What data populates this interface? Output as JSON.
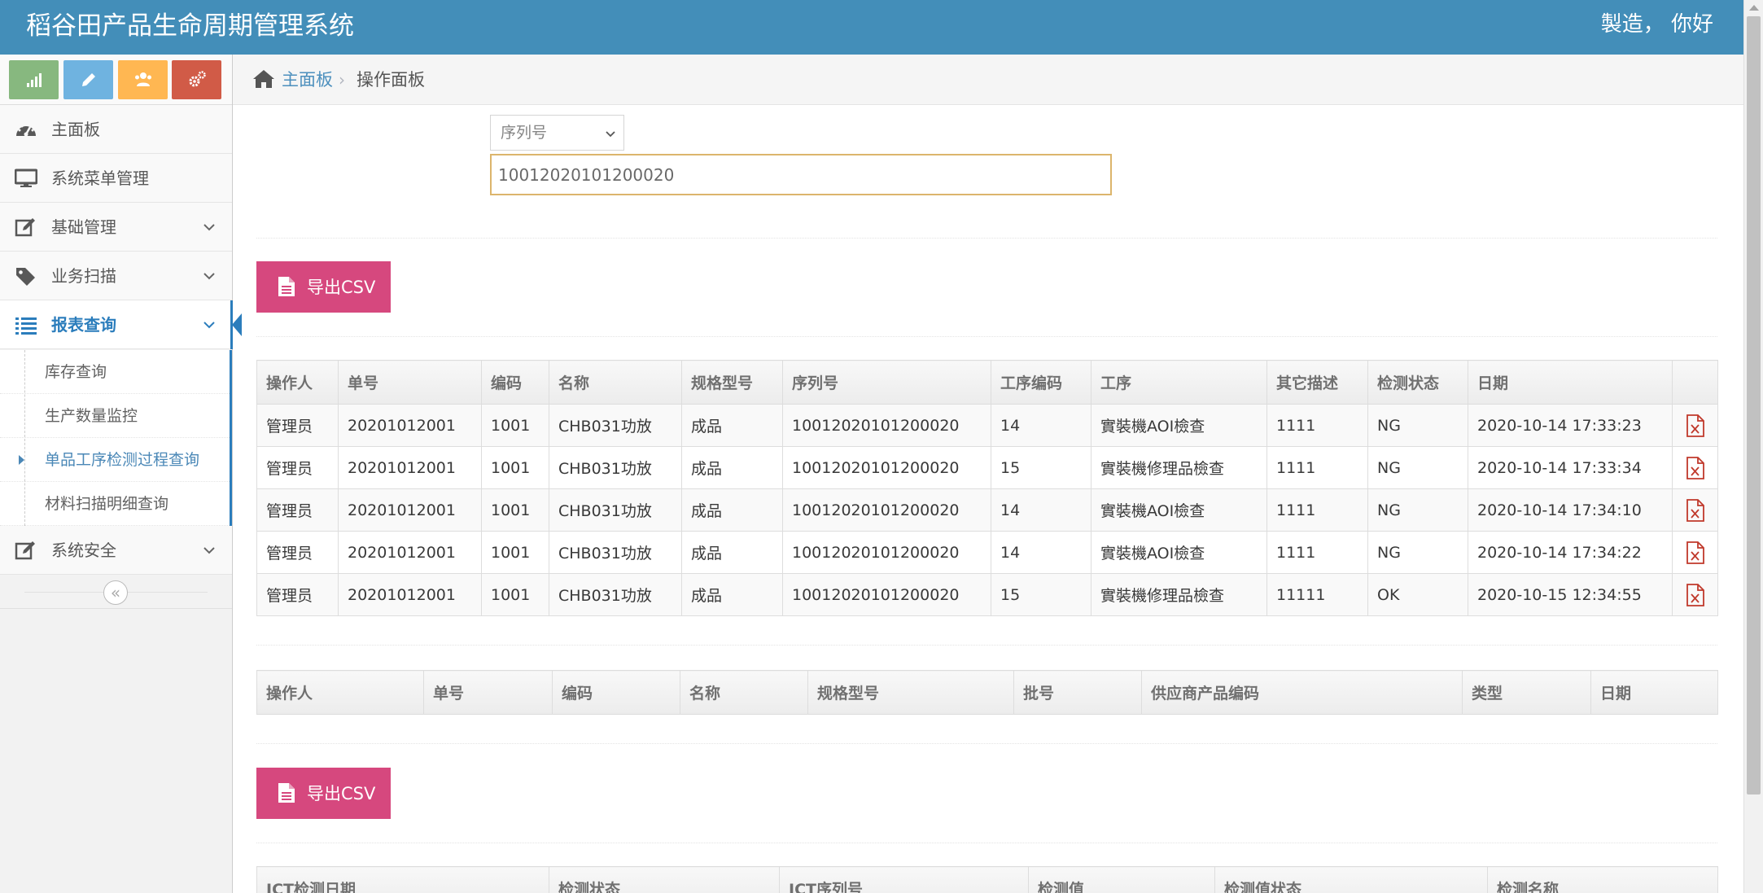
{
  "header": {
    "title": "稻谷田产品生命周期管理系统",
    "greeting": "製造， 你好"
  },
  "sidebar": {
    "shortcuts": [
      {
        "icon": "signal-icon",
        "color": "#87b87f"
      },
      {
        "icon": "pencil-icon",
        "color": "#6fb3e0"
      },
      {
        "icon": "users-icon",
        "color": "#ffb752"
      },
      {
        "icon": "cogs-icon",
        "color": "#d15b47"
      }
    ],
    "items": [
      {
        "label": "主面板",
        "icon": "dashboard-icon"
      },
      {
        "label": "系统菜单管理",
        "icon": "desktop-icon"
      },
      {
        "label": "基础管理",
        "icon": "edit-icon"
      },
      {
        "label": "业务扫描",
        "icon": "tag-icon"
      },
      {
        "label": "报表查询",
        "icon": "list-icon"
      },
      {
        "label": "系统安全",
        "icon": "edit-icon"
      }
    ],
    "submenu": [
      {
        "label": "库存查询"
      },
      {
        "label": "生产数量监控"
      },
      {
        "label": "单品工序检测过程查询"
      },
      {
        "label": "材料扫描明细查询"
      }
    ],
    "collapse_glyph": "«"
  },
  "breadcrumb": {
    "home": "主面板",
    "separator": "›",
    "current": "操作面板"
  },
  "search": {
    "field_select": "序列号",
    "value": "10012020101200020"
  },
  "export_label": "导出CSV",
  "process_table": {
    "headers": [
      "操作人",
      "单号",
      "编码",
      "名称",
      "规格型号",
      "序列号",
      "工序编码",
      "工序",
      "其它描述",
      "检测状态",
      "日期"
    ],
    "rows": [
      [
        "管理员",
        "20201012001",
        "1001",
        "CHB031功放",
        "成品",
        "10012020101200020",
        "14",
        "實裝機AOI檢查",
        "1111",
        "NG",
        "2020-10-14 17:33:23"
      ],
      [
        "管理员",
        "20201012001",
        "1001",
        "CHB031功放",
        "成品",
        "10012020101200020",
        "15",
        "實裝機修理品檢查",
        "1111",
        "NG",
        "2020-10-14 17:33:34"
      ],
      [
        "管理员",
        "20201012001",
        "1001",
        "CHB031功放",
        "成品",
        "10012020101200020",
        "14",
        "實裝機AOI檢查",
        "1111",
        "NG",
        "2020-10-14 17:34:10"
      ],
      [
        "管理员",
        "20201012001",
        "1001",
        "CHB031功放",
        "成品",
        "10012020101200020",
        "14",
        "實裝機AOI檢查",
        "1111",
        "NG",
        "2020-10-14 17:34:22"
      ],
      [
        "管理员",
        "20201012001",
        "1001",
        "CHB031功放",
        "成品",
        "10012020101200020",
        "15",
        "實裝機修理品檢查",
        "11111",
        "OK",
        "2020-10-15 12:34:55"
      ]
    ]
  },
  "material_table": {
    "headers": [
      "操作人",
      "单号",
      "编码",
      "名称",
      "规格型号",
      "批号",
      "供应商产品编码",
      "类型",
      "日期"
    ]
  },
  "ict_table": {
    "headers": [
      "ICT检测日期",
      "检测状态",
      "ICT序列号",
      "检测值",
      "检测值状态",
      "检测名称"
    ]
  }
}
